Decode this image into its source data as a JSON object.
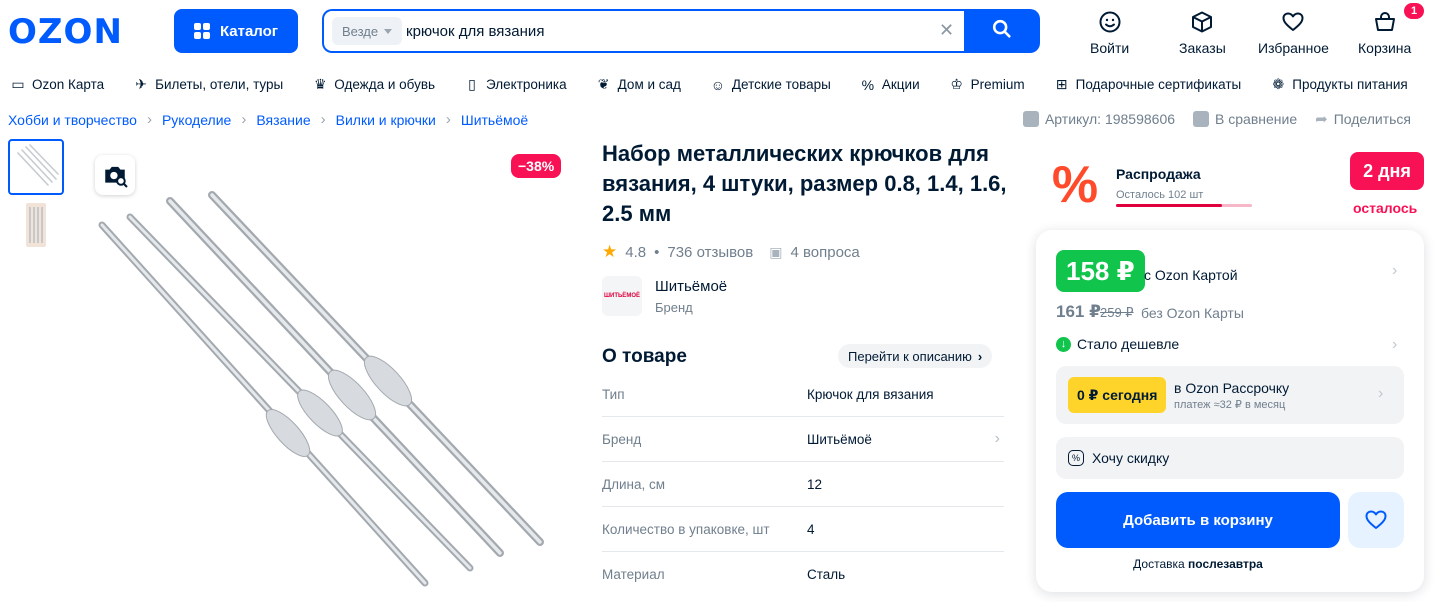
{
  "header": {
    "logo": "OZON",
    "catalog_label": "Каталог",
    "search_scope": "Везде",
    "search_value": "крючок для вязания",
    "actions": {
      "login": "Войти",
      "orders": "Заказы",
      "favorites": "Избранное",
      "cart": "Корзина"
    },
    "cart_count": "1"
  },
  "nav": [
    "Ozon Карта",
    "Билеты, отели, туры",
    "Одежда и обувь",
    "Электроника",
    "Дом и сад",
    "Детские товары",
    "Акции",
    "Premium",
    "Подарочные сертификаты",
    "Продукты питания"
  ],
  "breadcrumbs": [
    "Хобби и творчество",
    "Рукоделие",
    "Вязание",
    "Вилки и крючки",
    "Шитьёмоё"
  ],
  "meta": {
    "article": "Артикул: 198598606",
    "compare": "В сравнение",
    "share": "Поделиться"
  },
  "gallery": {
    "discount": "−38%"
  },
  "product": {
    "title": "Набор металлических крючков для вязания, 4 штуки, размер 0.8, 1.4, 1.6, 2.5 мм",
    "rating": "4.8",
    "reviews": "736 отзывов",
    "questions": "4 вопроса",
    "brand_logo_text": "ШИТЬЁМОЁ",
    "brand_name": "Шитьёмоё",
    "brand_sub": "Бренд"
  },
  "about": {
    "title": "О товаре",
    "link": "Перейти к описанию",
    "specs": [
      {
        "k": "Тип",
        "v": "Крючок для вязания"
      },
      {
        "k": "Бренд",
        "v": "Шитьёмоё"
      },
      {
        "k": "Длина, см",
        "v": "12"
      },
      {
        "k": "Количество в упаковке, шт",
        "v": "4"
      },
      {
        "k": "Материал",
        "v": "Сталь"
      }
    ]
  },
  "sale": {
    "title": "Распродажа",
    "left": "Осталось 102 шт",
    "progress": 0.78,
    "days": "2 дня",
    "days_left": "осталось"
  },
  "buybox": {
    "price_card": "158 ₽",
    "price_card_label": "с Ozon Картой",
    "price": "161 ₽",
    "price_old": "259 ₽",
    "price_no_card": "без Ozon Карты",
    "cheaper": "Стало дешевле",
    "installment_badge": "0 ₽ сегодня",
    "installment_title": "в Ozon Рассрочку",
    "installment_sub": "платеж ≈32 ₽ в месяц",
    "want_discount": "Хочу скидку",
    "add_to_cart": "Добавить в корзину",
    "delivery_prefix": "Доставка",
    "delivery_when": "послезавтра"
  },
  "colors": {
    "brand": "#005bff",
    "sale": "#f91155",
    "price_green": "#10c44c",
    "installment": "#fed42b"
  }
}
